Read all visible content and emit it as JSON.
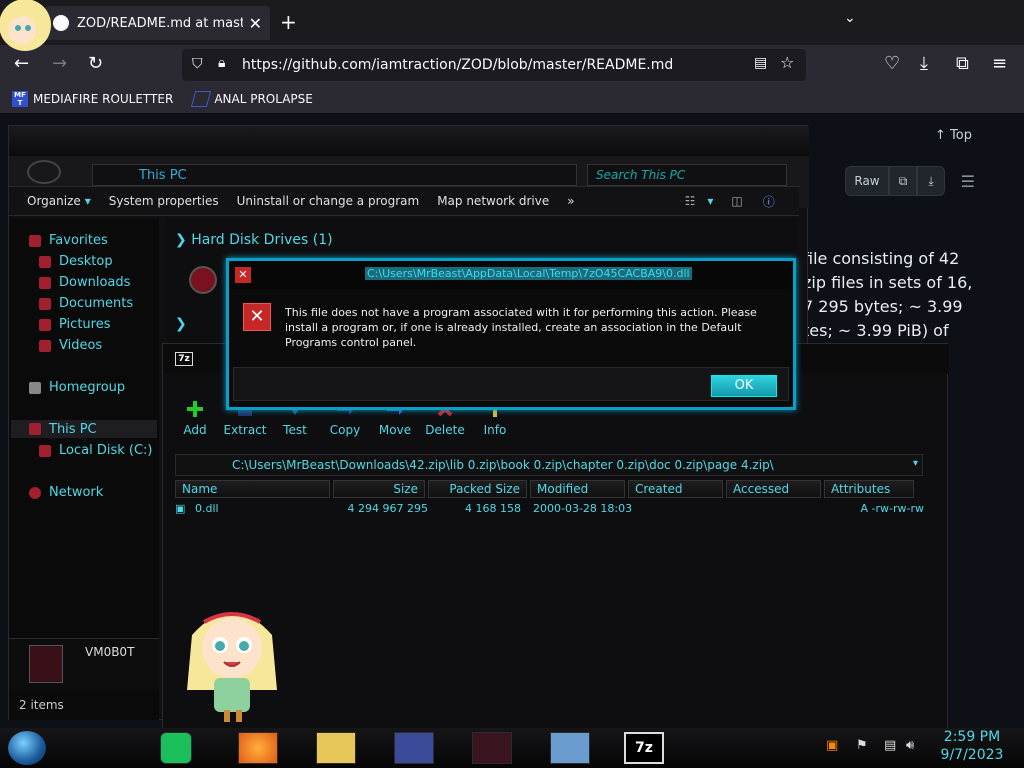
{
  "browser": {
    "tab_title": "ZOD/README.md at master · ia",
    "url": "https://github.com/iamtraction/ZOD/blob/master/README.md",
    "bookmarks": [
      {
        "label": "MEDIAFIRE ROULETTER",
        "icon_text": "MF T"
      },
      {
        "label": "ANAL PROLAPSE"
      }
    ]
  },
  "github": {
    "top_label": "Top",
    "raw_label": "Raw",
    "text_lines": [
      "file consisting of 42",
      "zip files in sets of 16,",
      "7 295 bytes; ~ 3.99",
      "tes; ~ 3.99 PiB) of"
    ]
  },
  "explorer": {
    "address": "This PC",
    "search_placeholder": "Search This PC",
    "commands": [
      "Organize",
      "System properties",
      "Uninstall or change a program",
      "Map network drive",
      "»"
    ],
    "nav": {
      "favorites": "Favorites",
      "desktop": "Desktop",
      "downloads": "Downloads",
      "documents": "Documents",
      "pictures": "Pictures",
      "videos": "Videos",
      "homegroup": "Homegroup",
      "this_pc": "This PC",
      "local_disk": "Local Disk (C:)",
      "network": "Network"
    },
    "group_header": "Hard Disk Drives (1)",
    "computer_name": "VM0B0T",
    "status": "2 items"
  },
  "sevenzip": {
    "title_icon": "7z",
    "toolbar": [
      "Add",
      "Extract",
      "Test",
      "Copy",
      "Move",
      "Delete",
      "Info"
    ],
    "path": "C:\\Users\\MrBeast\\Downloads\\42.zip\\lib 0.zip\\book 0.zip\\chapter 0.zip\\doc 0.zip\\page 4.zip\\",
    "columns": [
      "Name",
      "Size",
      "Packed Size",
      "Modified",
      "Created",
      "Accessed",
      "Attributes"
    ],
    "rows": [
      {
        "name": "0.dll",
        "size": "4 294 967 295",
        "packed": "4 168 158",
        "modified": "2000-03-28 18:03",
        "created": "",
        "accessed": "",
        "attributes": "A -rw-rw-rw"
      }
    ]
  },
  "dialog": {
    "title": "C:\\Users\\MrBeast\\AppData\\Local\\Temp\\7zO45CACBA9\\0.dll",
    "message": "This file does not have a program associated with it for performing this action. Please install a program or, if one is already installed, create an association in the Default Programs control panel.",
    "ok": "OK"
  },
  "taskbar": {
    "time": "2:59 PM",
    "date": "9/7/2023",
    "app_7z": "7z"
  },
  "colors": {
    "accent": "#4fd9e8",
    "dialog_border": "#0a9fc9",
    "error_red": "#c62828"
  }
}
